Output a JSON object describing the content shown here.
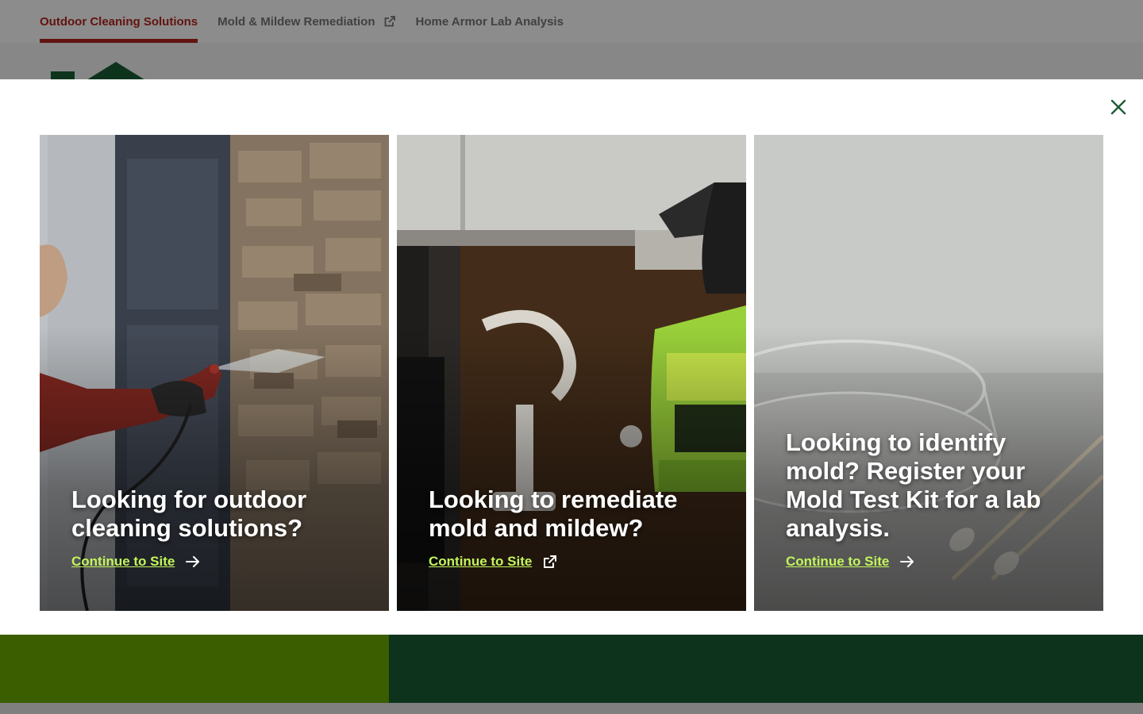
{
  "topnav": {
    "tabs": [
      {
        "label": "Outdoor Cleaning Solutions",
        "active": true
      },
      {
        "label": "Mold & Mildew Remediation",
        "external": true
      },
      {
        "label": "Home Armor Lab Analysis"
      }
    ]
  },
  "colors": {
    "accent_red": "#b3261e",
    "cta_green": "#c3f55c",
    "brand_dark_green": "#1b5e36",
    "brand_lime": "#6aab00"
  },
  "modal": {
    "close_icon": "close-icon",
    "cards": [
      {
        "heading": "Looking for outdoor cleaning solutions?",
        "cta": "Continue to Site",
        "cta_icon": "arrow-right-icon"
      },
      {
        "heading": "Looking to remediate mold and mildew?",
        "cta": "Continue to Site",
        "cta_icon": "external-link-icon"
      },
      {
        "heading": "Looking to identify mold? Register your Mold Test Kit for a lab analysis.",
        "cta": "Continue to Site",
        "cta_icon": "arrow-right-icon"
      }
    ]
  }
}
